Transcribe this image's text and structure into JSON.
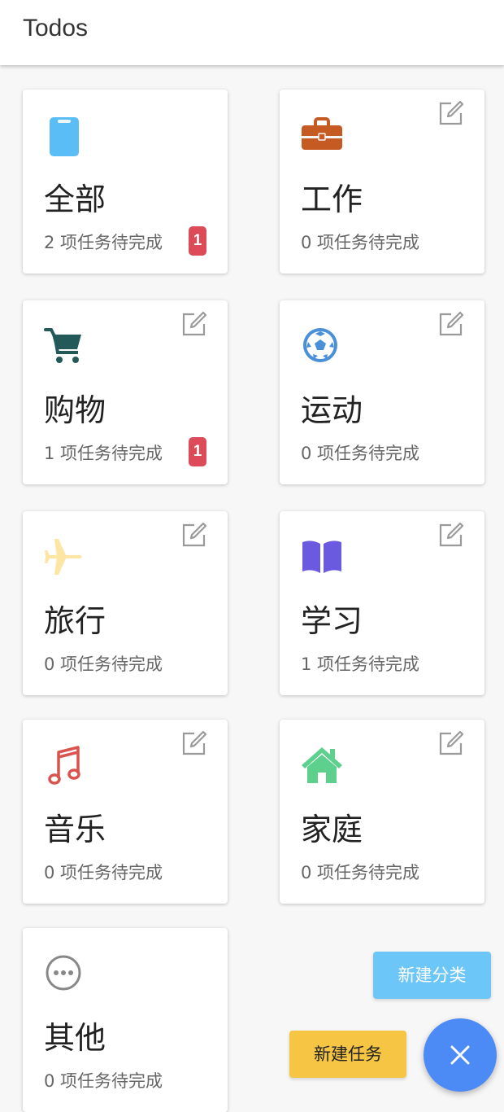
{
  "app": {
    "title": "Todos"
  },
  "colors": {
    "badge": "#dc4b57",
    "fab": "#4c8af5",
    "new_category_button": "#6cc6f8",
    "new_task_button": "#f5c543"
  },
  "categories": [
    {
      "name": "全部",
      "count_text": "2 项任务待完成",
      "badge": "1",
      "icon": "clipboard-icon",
      "icon_color": "#5bbdf6",
      "editable": false
    },
    {
      "name": "工作",
      "count_text": "0 项任务待完成",
      "badge": "",
      "icon": "briefcase-icon",
      "icon_color": "#c55a23",
      "editable": true
    },
    {
      "name": "购物",
      "count_text": "1 项任务待完成",
      "badge": "1",
      "icon": "shopping-cart-icon",
      "icon_color": "#24595a",
      "editable": true
    },
    {
      "name": "运动",
      "count_text": "0 项任务待完成",
      "badge": "",
      "icon": "soccer-ball-icon",
      "icon_color": "#4a90d9",
      "editable": true
    },
    {
      "name": "旅行",
      "count_text": "0 项任务待完成",
      "badge": "",
      "icon": "airplane-icon",
      "icon_color": "#fde5a3",
      "editable": true
    },
    {
      "name": "学习",
      "count_text": "1 项任务待完成",
      "badge": "",
      "icon": "book-icon",
      "icon_color": "#6a5ae0",
      "editable": true
    },
    {
      "name": "音乐",
      "count_text": "0 项任务待完成",
      "badge": "",
      "icon": "music-note-icon",
      "icon_color": "#d9534f",
      "editable": true
    },
    {
      "name": "家庭",
      "count_text": "0 项任务待完成",
      "badge": "",
      "icon": "home-icon",
      "icon_color": "#5ed08e",
      "editable": true
    },
    {
      "name": "其他",
      "count_text": "0 项任务待完成",
      "badge": "",
      "icon": "more-horizontal-icon",
      "icon_color": "#888888",
      "editable": false
    }
  ],
  "actions": {
    "new_category_label": "新建分类",
    "new_task_label": "新建任务",
    "fab_icon": "close-icon"
  }
}
